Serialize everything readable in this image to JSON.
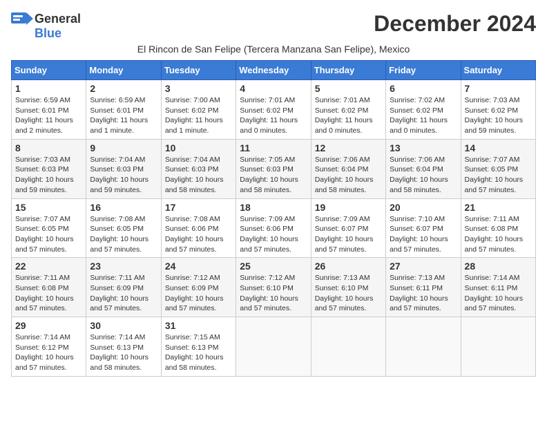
{
  "header": {
    "logo_general": "General",
    "logo_blue": "Blue",
    "month_title": "December 2024",
    "subtitle": "El Rincon de San Felipe (Tercera Manzana San Felipe), Mexico"
  },
  "weekdays": [
    "Sunday",
    "Monday",
    "Tuesday",
    "Wednesday",
    "Thursday",
    "Friday",
    "Saturday"
  ],
  "weeks": [
    [
      {
        "day": "1",
        "info": "Sunrise: 6:59 AM\nSunset: 6:01 PM\nDaylight: 11 hours and 2 minutes."
      },
      {
        "day": "2",
        "info": "Sunrise: 6:59 AM\nSunset: 6:01 PM\nDaylight: 11 hours and 1 minute."
      },
      {
        "day": "3",
        "info": "Sunrise: 7:00 AM\nSunset: 6:02 PM\nDaylight: 11 hours and 1 minute."
      },
      {
        "day": "4",
        "info": "Sunrise: 7:01 AM\nSunset: 6:02 PM\nDaylight: 11 hours and 0 minutes."
      },
      {
        "day": "5",
        "info": "Sunrise: 7:01 AM\nSunset: 6:02 PM\nDaylight: 11 hours and 0 minutes."
      },
      {
        "day": "6",
        "info": "Sunrise: 7:02 AM\nSunset: 6:02 PM\nDaylight: 11 hours and 0 minutes."
      },
      {
        "day": "7",
        "info": "Sunrise: 7:03 AM\nSunset: 6:02 PM\nDaylight: 10 hours and 59 minutes."
      }
    ],
    [
      {
        "day": "8",
        "info": "Sunrise: 7:03 AM\nSunset: 6:03 PM\nDaylight: 10 hours and 59 minutes."
      },
      {
        "day": "9",
        "info": "Sunrise: 7:04 AM\nSunset: 6:03 PM\nDaylight: 10 hours and 59 minutes."
      },
      {
        "day": "10",
        "info": "Sunrise: 7:04 AM\nSunset: 6:03 PM\nDaylight: 10 hours and 58 minutes."
      },
      {
        "day": "11",
        "info": "Sunrise: 7:05 AM\nSunset: 6:03 PM\nDaylight: 10 hours and 58 minutes."
      },
      {
        "day": "12",
        "info": "Sunrise: 7:06 AM\nSunset: 6:04 PM\nDaylight: 10 hours and 58 minutes."
      },
      {
        "day": "13",
        "info": "Sunrise: 7:06 AM\nSunset: 6:04 PM\nDaylight: 10 hours and 58 minutes."
      },
      {
        "day": "14",
        "info": "Sunrise: 7:07 AM\nSunset: 6:05 PM\nDaylight: 10 hours and 57 minutes."
      }
    ],
    [
      {
        "day": "15",
        "info": "Sunrise: 7:07 AM\nSunset: 6:05 PM\nDaylight: 10 hours and 57 minutes."
      },
      {
        "day": "16",
        "info": "Sunrise: 7:08 AM\nSunset: 6:05 PM\nDaylight: 10 hours and 57 minutes."
      },
      {
        "day": "17",
        "info": "Sunrise: 7:08 AM\nSunset: 6:06 PM\nDaylight: 10 hours and 57 minutes."
      },
      {
        "day": "18",
        "info": "Sunrise: 7:09 AM\nSunset: 6:06 PM\nDaylight: 10 hours and 57 minutes."
      },
      {
        "day": "19",
        "info": "Sunrise: 7:09 AM\nSunset: 6:07 PM\nDaylight: 10 hours and 57 minutes."
      },
      {
        "day": "20",
        "info": "Sunrise: 7:10 AM\nSunset: 6:07 PM\nDaylight: 10 hours and 57 minutes."
      },
      {
        "day": "21",
        "info": "Sunrise: 7:11 AM\nSunset: 6:08 PM\nDaylight: 10 hours and 57 minutes."
      }
    ],
    [
      {
        "day": "22",
        "info": "Sunrise: 7:11 AM\nSunset: 6:08 PM\nDaylight: 10 hours and 57 minutes."
      },
      {
        "day": "23",
        "info": "Sunrise: 7:11 AM\nSunset: 6:09 PM\nDaylight: 10 hours and 57 minutes."
      },
      {
        "day": "24",
        "info": "Sunrise: 7:12 AM\nSunset: 6:09 PM\nDaylight: 10 hours and 57 minutes."
      },
      {
        "day": "25",
        "info": "Sunrise: 7:12 AM\nSunset: 6:10 PM\nDaylight: 10 hours and 57 minutes."
      },
      {
        "day": "26",
        "info": "Sunrise: 7:13 AM\nSunset: 6:10 PM\nDaylight: 10 hours and 57 minutes."
      },
      {
        "day": "27",
        "info": "Sunrise: 7:13 AM\nSunset: 6:11 PM\nDaylight: 10 hours and 57 minutes."
      },
      {
        "day": "28",
        "info": "Sunrise: 7:14 AM\nSunset: 6:11 PM\nDaylight: 10 hours and 57 minutes."
      }
    ],
    [
      {
        "day": "29",
        "info": "Sunrise: 7:14 AM\nSunset: 6:12 PM\nDaylight: 10 hours and 57 minutes."
      },
      {
        "day": "30",
        "info": "Sunrise: 7:14 AM\nSunset: 6:13 PM\nDaylight: 10 hours and 58 minutes."
      },
      {
        "day": "31",
        "info": "Sunrise: 7:15 AM\nSunset: 6:13 PM\nDaylight: 10 hours and 58 minutes."
      },
      null,
      null,
      null,
      null
    ]
  ]
}
